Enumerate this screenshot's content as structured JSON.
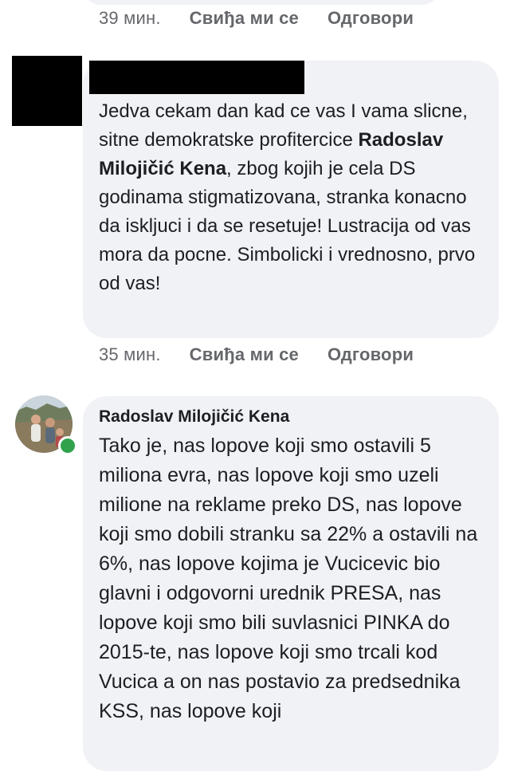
{
  "comments": [
    {
      "time": "39 мин.",
      "like_label": "Свиђа ми се",
      "reply_label": "Одговори"
    },
    {
      "text_before": "Jedva cekam dan kad ce vas I vama slicne, sitne demokratske profitercice ",
      "mention": "Radoslav Milojičić Kena",
      "text_after": ", zbog kojih je cela DS godinama stigmatizovana, stranka konacno da iskljuci i da se resetuje! Lustracija od vas mora da pocne. Simbolicki i vrednosno, prvo od vas!",
      "time": "35 мин.",
      "like_label": "Свиђа ми се",
      "reply_label": "Одговори"
    },
    {
      "author": "Radoslav Milojičić Kena",
      "text": "Tako je, nas lopove koji smo ostavili 5 miliona evra, nas lopove koji smo uzeli milione na reklame preko DS, nas lopove koji smo dobili stranku sa 22% a ostavili na 6%, nas lopove kojima je Vucicevic bio glavni i odgovorni urednik PRESA, nas lopove koji smo bili suvlasnici PINKA do 2015-te, nas lopove koji smo trcali kod Vucica a on nas postavio za predsednika KSS, nas lopove koji"
    }
  ],
  "colors": {
    "bubble_bg": "#f0f2f5",
    "meta_text": "#65676b",
    "online": "#31a24c"
  }
}
